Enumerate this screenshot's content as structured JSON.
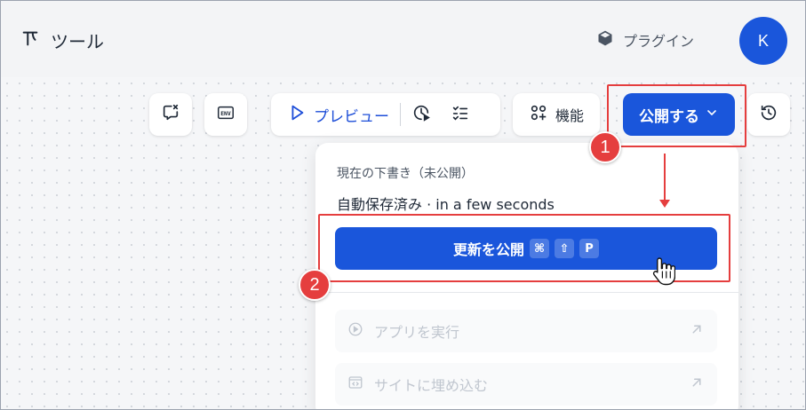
{
  "header": {
    "app_title": "ツール",
    "plugin_label": "プラグイン",
    "avatar_initial": "K"
  },
  "toolbar": {
    "preview_label": "プレビュー",
    "features_label": "機能",
    "publish_label": "公開する"
  },
  "publish_menu": {
    "status": "現在の下書き（未公開）",
    "autosave": "自動保存済み · in a few seconds",
    "update_button": {
      "label": "更新を公開",
      "shortcut_keys": [
        "⌘",
        "⇧",
        "P"
      ]
    },
    "items": [
      {
        "label": "アプリを実行",
        "icon": "play-circle-icon",
        "disabled": true
      },
      {
        "label": "サイトに埋め込む",
        "icon": "embed-icon",
        "disabled": true
      }
    ]
  },
  "annotations": {
    "step1": "1",
    "step2": "2"
  },
  "colors": {
    "primary": "#1a56db",
    "annotation": "#e53e3e"
  }
}
